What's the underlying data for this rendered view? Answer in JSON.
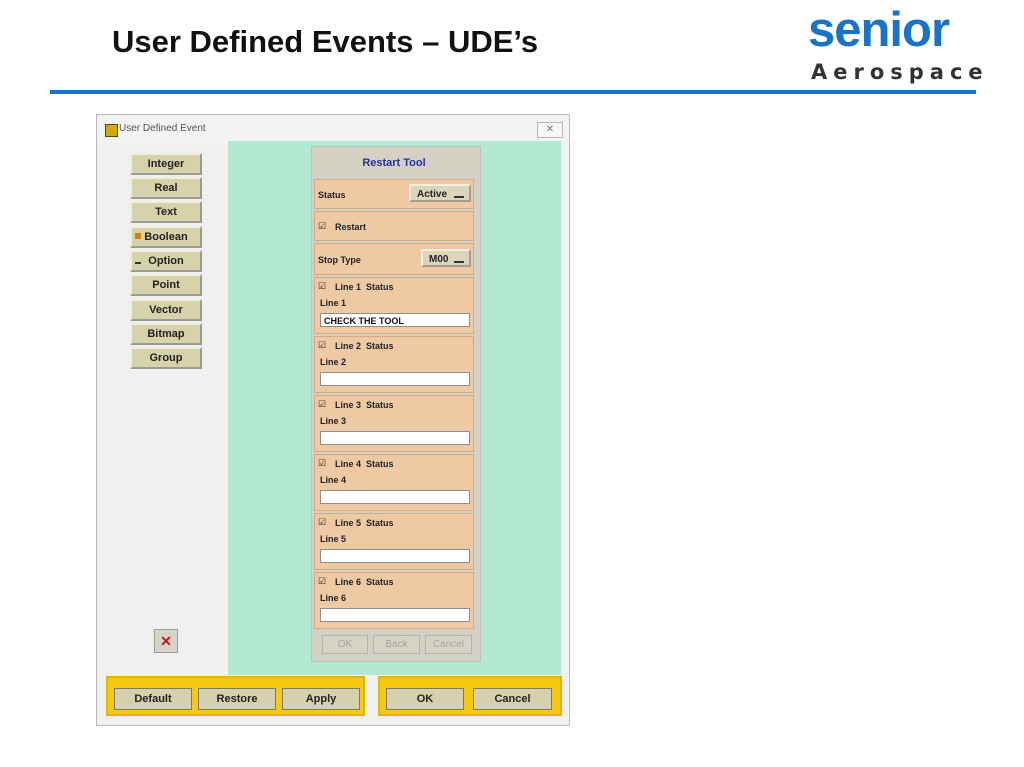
{
  "slide": {
    "title": "User Defined Events – UDE’s",
    "logo_word": "senior",
    "logo_sub": "Aerospace",
    "logo_color": "#1a72c9"
  },
  "window": {
    "title": "User Defined Event",
    "close_label": "✕"
  },
  "types": [
    {
      "label": "Integer"
    },
    {
      "label": "Real"
    },
    {
      "label": "Text"
    },
    {
      "label": "Boolean"
    },
    {
      "label": "Option"
    },
    {
      "label": "Point"
    },
    {
      "label": "Vector"
    },
    {
      "label": "Bitmap"
    },
    {
      "label": "Group"
    }
  ],
  "trash_icon": "trash-icon",
  "panel": {
    "title": "Restart Tool",
    "status_label": "Status",
    "status_value": "Active",
    "restart_label": "Restart",
    "stop_type_label": "Stop Type",
    "stop_type_value": "M00",
    "lines": [
      {
        "check": "Line 1  Status",
        "label": "Line 1",
        "value": "CHECK THE TOOL"
      },
      {
        "check": "Line 2  Status",
        "label": "Line 2",
        "value": ""
      },
      {
        "check": "Line 3  Status",
        "label": "Line 3",
        "value": ""
      },
      {
        "check": "Line 4  Status",
        "label": "Line 4",
        "value": ""
      },
      {
        "check": "Line 5  Status",
        "label": "Line 5",
        "value": ""
      },
      {
        "check": "Line 6  Status",
        "label": "Line 6",
        "value": ""
      }
    ],
    "ok_label": "OK",
    "back_label": "Back",
    "cancel_label": "Cancel"
  },
  "bottom": {
    "default_label": "Default",
    "restore_label": "Restore",
    "apply_label": "Apply",
    "ok_label": "OK",
    "cancel_label": "Cancel"
  }
}
